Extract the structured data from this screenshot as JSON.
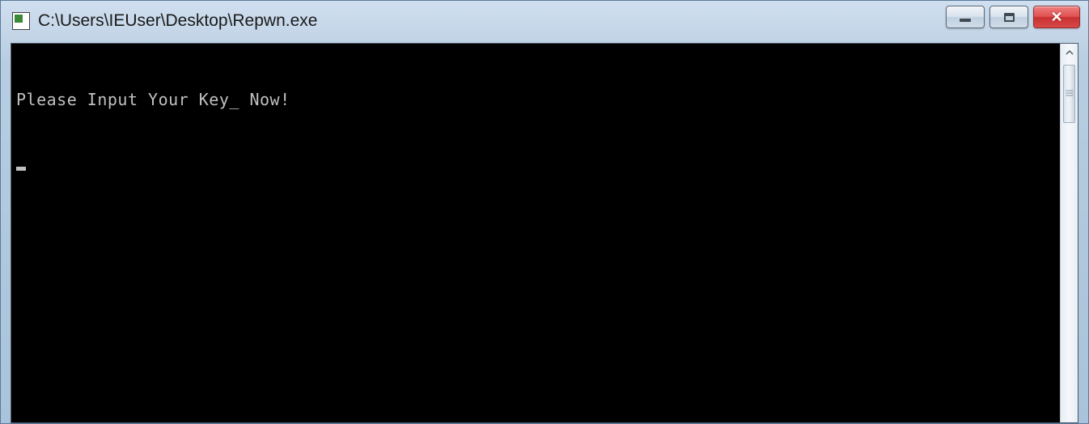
{
  "window": {
    "title": "C:\\Users\\IEUser\\Desktop\\Repwn.exe",
    "icon": "console-app-icon"
  },
  "controls": {
    "minimize": "minimize",
    "maximize": "maximize",
    "close": "close"
  },
  "console": {
    "lines": [
      "Please Input Your Key_ Now!"
    ],
    "cursor_visible": true
  },
  "colors": {
    "console_bg": "#000000",
    "console_fg": "#c0c0c0",
    "titlebar_gradient_start": "#d0dff0",
    "titlebar_gradient_end": "#a8c3db",
    "close_bg": "#d84848"
  }
}
